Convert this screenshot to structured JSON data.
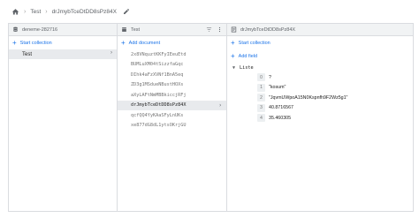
{
  "breadcrumb": {
    "home_icon": "home-icon",
    "items": [
      "Test",
      "drJmybTceDtDD8sPz84X"
    ],
    "edit_icon": "pencil-icon"
  },
  "columns": {
    "root": {
      "header": "deneme-282716",
      "action": "Start collection",
      "collections": [
        "Test"
      ]
    },
    "collection": {
      "header": "Test",
      "action": "Add document",
      "documents": [
        "2x8VNquztKKFyIEeuEtd",
        "BUMLuXM04tSizzfaGqc",
        "DIhk4aFzXVNf1BnA5eq",
        "ZD3g1MSdueNBustHOXs",
        "aXyLAFtNmMBBkiccjRFj",
        "drJmybTceDtDD8sPz84X",
        "qcfQQ4YyKAaSFyLnUKs",
        "xe877dG8dL1ytsOKrjGU"
      ],
      "selected_index": 5
    },
    "document": {
      "header": "drJmybTceDtDD8sPz84X",
      "action_collection": "Start collection",
      "action_field": "Add field",
      "field_name": "Liste",
      "array_values": [
        {
          "index": "0",
          "value": "?"
        },
        {
          "index": "1",
          "value": "\"kosum\""
        },
        {
          "index": "2",
          "value": "\"JqvmUWpoA15N0Kspnfh9F2Wz5g1\""
        },
        {
          "index": "3",
          "value": "40.8716567"
        },
        {
          "index": "4",
          "value": "35.460305"
        }
      ]
    }
  },
  "colors": {
    "accent": "#1a73e8",
    "selected_bg": "#e8eaed",
    "header_bg": "#f1f3f4",
    "border": "#dadce0"
  }
}
